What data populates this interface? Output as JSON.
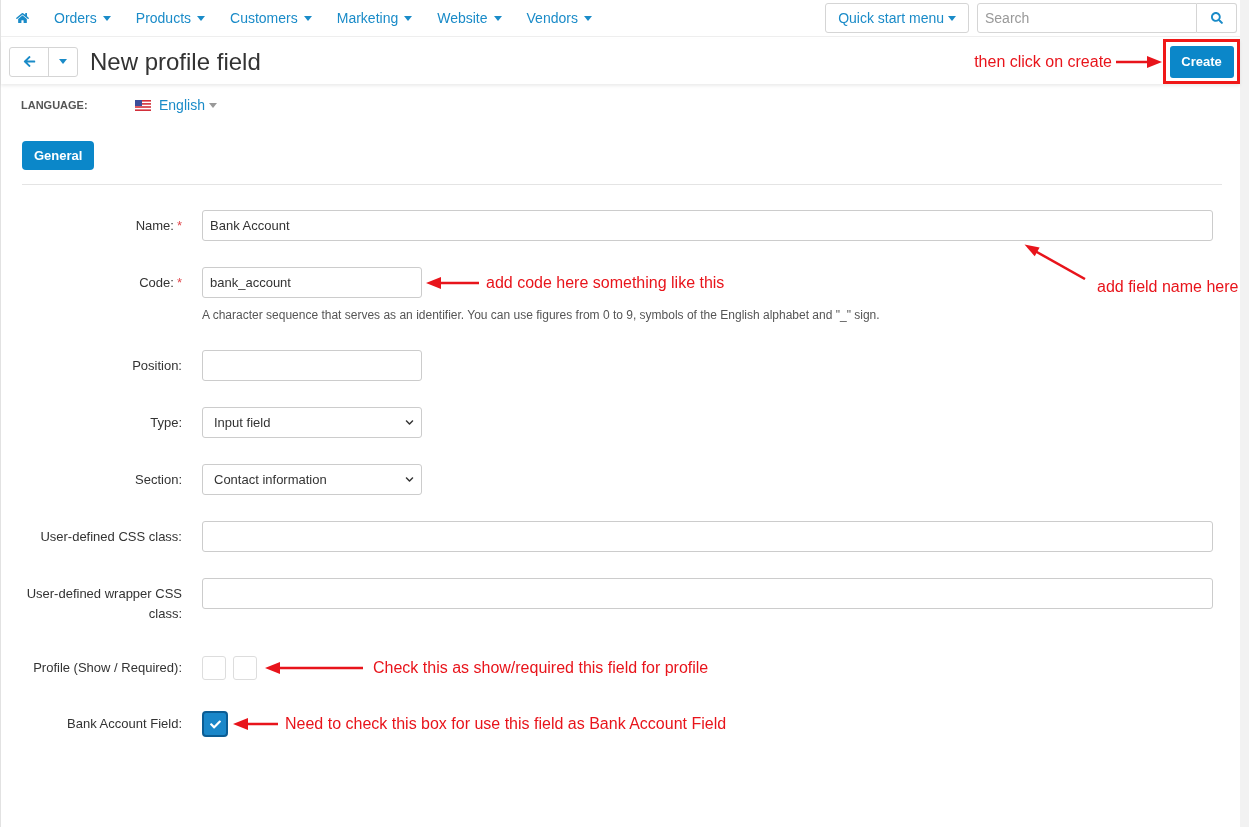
{
  "top_nav": {
    "items": [
      "Orders",
      "Products",
      "Customers",
      "Marketing",
      "Website",
      "Vendors"
    ],
    "quick_start_menu": "Quick start menu",
    "search": {
      "placeholder": "Search"
    }
  },
  "header": {
    "title": "New profile field",
    "annotation": "then click on create",
    "create_button": "Create"
  },
  "language": {
    "label": "LANGUAGE:",
    "value": "English"
  },
  "tabs": [
    {
      "label": "General",
      "selected": true
    }
  ],
  "form": {
    "fields": [
      {
        "kind": "text",
        "label": "Name:",
        "required_mark": "*",
        "value": "Bank Account"
      },
      {
        "kind": "short_text",
        "label": "Code:",
        "required_mark": "*",
        "value": "bank_account",
        "annotations": [
          {
            "kind": "inline",
            "text": "add code here something like this"
          },
          {
            "kind": "pointer_up",
            "text": "add field name here"
          }
        ],
        "help": "A character sequence that serves as an identifier. You can use figures from 0 to 9, symbols of the English alphabet and \"_\" sign."
      },
      {
        "kind": "short_text",
        "label": "Position:"
      },
      {
        "kind": "select",
        "label": "Type:",
        "value": "Input field"
      },
      {
        "kind": "select",
        "label": "Section:",
        "value": "Contact information"
      },
      {
        "kind": "text",
        "label": "User-defined CSS class:"
      },
      {
        "kind": "text",
        "label": "User-defined wrapper CSS class:"
      },
      {
        "kind": "checkboxes",
        "label": "Profile (Show / Required):",
        "checkboxes": [
          {
            "checked": false
          },
          {
            "checked": false
          }
        ],
        "annotations": [
          {
            "kind": "inline",
            "text": "Check this as show/required this field for profile"
          }
        ]
      },
      {
        "kind": "checkbox",
        "label": "Bank Account Field:",
        "checked": true,
        "annotations": [
          {
            "kind": "inline",
            "text": "Need to check this box for use this field as Bank Account Field"
          }
        ]
      }
    ]
  }
}
